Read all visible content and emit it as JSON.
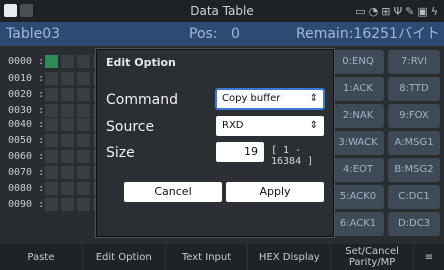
{
  "status_bar": {
    "title": "Data Table",
    "icons": [
      "battery-icon",
      "signal-icon",
      "lan-icon",
      "usb-icon",
      "tool-icon",
      "save-icon",
      "power-icon"
    ]
  },
  "header": {
    "table_name": "Table03",
    "pos_label": "Pos:",
    "pos_value": "0",
    "remain": "Remain:16251バイト"
  },
  "table": {
    "addresses": [
      "0000 :",
      "0010 :",
      "0020 :",
      "0030 :",
      "0040 :",
      "0050 :",
      "0060 :",
      "0070 :",
      "0080 :",
      "0090 :"
    ],
    "selected_cell": "0000:0"
  },
  "keys": [
    [
      "0:ENQ",
      "7:RVI"
    ],
    [
      "1:ACK",
      "8:TTD"
    ],
    [
      "2:NAK",
      "9:FOX"
    ],
    [
      "3:WACK",
      "A:MSG1"
    ],
    [
      "4:EOT",
      "B:MSG2"
    ],
    [
      "5:ACK0",
      "C:DC1"
    ],
    [
      "6:ACK1",
      "D:DC3"
    ]
  ],
  "toolbar": {
    "paste": "Paste",
    "edit_option": "Edit Option",
    "text_input": "Text Input",
    "hex_display": "HEX Display",
    "set_cancel": "Set/Cancel Parity/MP",
    "menu_icon": "menu-icon"
  },
  "dialog": {
    "title": "Edit Option",
    "command_label": "Command",
    "command_value": "Copy buffer",
    "source_label": "Source",
    "source_value": "RXD",
    "size_label": "Size",
    "size_value": "19",
    "size_range": "[ 1 - 16384 ]",
    "cancel": "Cancel",
    "apply": "Apply"
  }
}
